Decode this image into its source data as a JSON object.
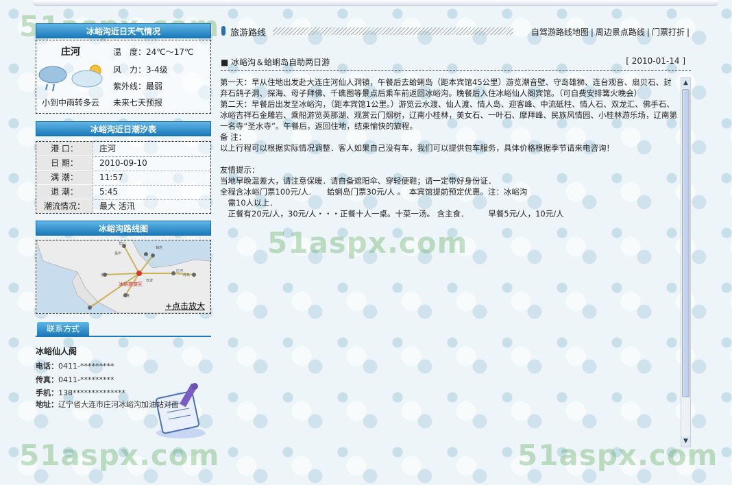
{
  "watermark": "51aspx.com",
  "weather": {
    "title": "冰峪沟近日天气情况",
    "city": "庄河",
    "temperature_label": "温　度：",
    "temperature": "24℃～17℃",
    "wind_label": "风　力：",
    "wind": "3-4级",
    "uv_label": "紫外线：",
    "uv": "最弱",
    "condition": "小到中雨转多云",
    "forecast_link": "未来七天预报"
  },
  "tide": {
    "title": "冰峪沟近日潮汐表",
    "rows": [
      {
        "label": "港 口：",
        "value": "庄河"
      },
      {
        "label": "日 期：",
        "value": "2010-09-10"
      },
      {
        "label": "满 潮：",
        "value": "11:57"
      },
      {
        "label": "退 潮：",
        "value": "5:45"
      },
      {
        "label": "潮流情况：",
        "value": "最大 活汛"
      }
    ]
  },
  "route_map": {
    "title": "冰峪沟路线图",
    "enlarge": "+点击放大",
    "center_label": "冰峪旅游区"
  },
  "contact": {
    "tab": "联系方式",
    "name": "冰峪仙人阁",
    "phone_label": "电话：",
    "phone": "0411-*********",
    "fax_label": "传真：",
    "fax": "0411-*********",
    "mobile_label": "手机：",
    "mobile": "138**************",
    "address_label": "地址：",
    "address": "辽宁省大连市庄河冰峪沟加油站对面"
  },
  "section": {
    "title": "旅游路线",
    "nav": [
      "自驾游路线地图",
      "周边景点路线",
      "门票打折"
    ]
  },
  "article": {
    "title": "冰峪沟＆蛤蜊岛自助两日游",
    "date": "[ 2010-01-14 ]",
    "paragraphs": [
      "第一天：早从住地出发赴大连庄河仙人洞镇，午餐后去蛤蜊岛（距本宾馆45公里）游览潮音壁、守岛雄狮、连台观音、扇贝石、封弃石鸽子洞、探海、母子拜佛、千礁图等景点后乘车前返回冰峪沟。晚餐后入住冰峪仙人阁宾馆。（可自费安排篝火晚会）",
      "第二天：早餐后出发至冰峪沟，（距本宾馆1公里。）游览云水渡、仙人渡、情人岛、迎客峰、中流砥柱、情人石、双龙汇、佛手石、冰峪吉祥石金雕岩、乘船游览英那湖、观赏云门烟树，辽南小桂林，美女石、一叶石、摩拜峰、民族风情园、小桂林游乐场，辽南第一名寺“圣水寺”。午餐后，返回住地，结束愉快的旅程。",
      "备 注：",
      "以上行程可以根据实际情况调整．客人如果自己没有车，我们可以提供包车服务，具体价格根据季节请来电咨询！",
      " ",
      "友情提示：",
      "当地早晚温差大，请注意保暖．请自备遮阳伞、穿轻便鞋；请一定带好身份证．",
      "全程含冰峪门票100元/人.　　蛤蜊岛门票30元/人 。　本宾馆提前预定优惠。注：冰峪沟",
      "　需10人以上．",
      "　正餐有20元/人，30元/人・・・正餐十人一桌。十菜一汤。 含主食．　　　早餐5元/人，10元/人"
    ]
  }
}
